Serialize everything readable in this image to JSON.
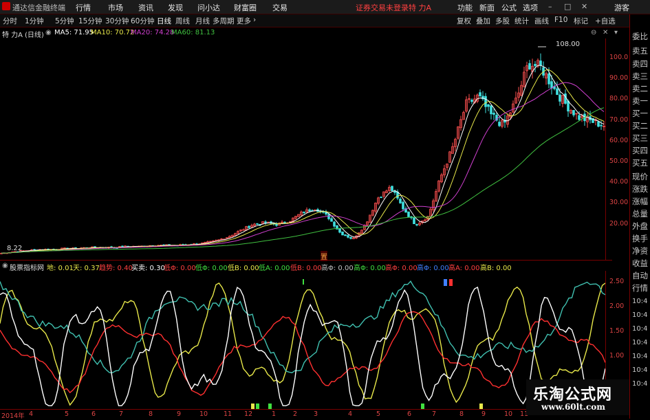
{
  "app": {
    "title": "通达信金融终端"
  },
  "menu": [
    "行情",
    "市场",
    "资讯",
    "发现",
    "问小达",
    "财富圈",
    "交易"
  ],
  "status": {
    "login": "证券交易未登录",
    "stock": "特 力A"
  },
  "menu_right": [
    "功能",
    "新面",
    "公式",
    "选项"
  ],
  "guest": "游客",
  "toolbar": [
    "分时",
    "1分钟",
    "5分钟",
    "15分钟",
    "30分钟",
    "60分钟",
    "日线",
    "周线",
    "月线",
    "多周期",
    "更多"
  ],
  "toolbar_active": "日线",
  "toolbar_right": [
    "复权",
    "叠加",
    "多股",
    "统计",
    "画线",
    "F10",
    "标记",
    "+自选"
  ],
  "corner": {
    "l": "L",
    "r": "R"
  },
  "ma_line": {
    "stock": "特 力A",
    "period": "(日线)",
    "ma5": "MA5: 71.95",
    "ma10": "MA10: 70.72",
    "ma20": "MA20: 74.28",
    "ma60": "MA60: 81.13"
  },
  "price_axis": [
    "100.0",
    "90.00",
    "80.00",
    "70.00",
    "60.00",
    "50.00",
    "40.00",
    "30.00",
    "20.00"
  ],
  "price_labels": {
    "high": "108.00",
    "low": "8.22",
    "tag": "置"
  },
  "ind_line": {
    "name": "股票指标网",
    "items": [
      {
        "label": "地: 0.01",
        "color": "#e8e84a"
      },
      {
        "label": "天: 0.37",
        "color": "#e8e84a"
      },
      {
        "label": "趋势: 0.40",
        "color": "#ff4040"
      },
      {
        "label": "买卖: 0.30",
        "color": "#ffffff"
      },
      {
        "label": "低Φ: 0.00",
        "color": "#ff4040"
      },
      {
        "label": "低Φ: 0.00",
        "color": "#40e040"
      },
      {
        "label": "低B: 0.00",
        "color": "#e8e84a"
      },
      {
        "label": "低A: 0.00",
        "color": "#40e040"
      },
      {
        "label": "低B: 0.00",
        "color": "#ff4040"
      },
      {
        "label": "高Φ: 0.00",
        "color": "#c0c0c0"
      },
      {
        "label": "高Φ: 0.00",
        "color": "#40e040"
      },
      {
        "label": "高Φ: 0.00",
        "color": "#ff4040"
      },
      {
        "label": "高Φ: 0.00",
        "color": "#4080ff"
      },
      {
        "label": "高A: 0.00",
        "color": "#ff4040"
      },
      {
        "label": "高B: 0.00",
        "color": "#e8e84a"
      }
    ]
  },
  "ind_axis": [
    "2.50",
    "2.00",
    "1.50",
    "1.00"
  ],
  "x_axis": [
    "2014年",
    "4",
    "5",
    "6",
    "7",
    "8",
    "9",
    "10",
    "11",
    "12",
    "1",
    "2",
    "3",
    "4",
    "5",
    "6",
    "7",
    "8",
    "9",
    "10",
    "11"
  ],
  "right_panel": [
    "委比",
    "卖五",
    "卖四",
    "卖三",
    "卖二",
    "卖一",
    "买一",
    "买二",
    "买三",
    "买四",
    "买五",
    "现价",
    "涨跌",
    "涨幅",
    "总量",
    "外盘",
    "换手",
    "净资",
    "收益",
    "自动",
    "行情"
  ],
  "right_times": [
    "10:4",
    "10:4",
    "10:4",
    "10:4",
    "10:4",
    "10:4",
    "10:4"
  ],
  "watermark": {
    "title": "乐淘公式网",
    "url": "www.60lt.com"
  },
  "chart_data": [
    {
      "type": "candlestick",
      "title": "特 力A (日线)",
      "series": [
        {
          "name": "MA5",
          "color": "#ffffff",
          "last": 71.95
        },
        {
          "name": "MA10",
          "color": "#e8e84a",
          "last": 70.72
        },
        {
          "name": "MA20",
          "color": "#d040d0",
          "last": 74.28
        },
        {
          "name": "MA60",
          "color": "#40c040",
          "last": 81.13
        }
      ],
      "ylim": [
        5,
        112
      ],
      "approx_close": [
        8.2,
        9,
        9.5,
        10,
        10,
        10.5,
        10.5,
        11,
        11,
        11,
        11.5,
        11.5,
        12,
        12,
        12,
        12.5,
        13,
        14,
        16,
        19,
        22,
        23,
        22,
        24,
        28,
        30,
        26,
        18,
        15,
        22,
        35,
        40,
        30,
        22,
        26,
        45,
        60,
        80,
        84,
        75,
        70,
        82,
        100,
        98,
        88,
        80,
        74,
        72,
        70
      ],
      "high_label": 108.0,
      "low_label": 8.22
    },
    {
      "type": "line",
      "title": "股票指标网",
      "ylim": [
        0.7,
        2.8
      ],
      "series": [
        {
          "name": "地",
          "color": "#e8e84a",
          "last": 0.01
        },
        {
          "name": "天",
          "color": "#e8e84a",
          "last": 0.37
        },
        {
          "name": "趋势",
          "color": "#ff4040",
          "last": 0.4
        },
        {
          "name": "买卖",
          "color": "#ffffff",
          "last": 0.3
        }
      ]
    }
  ]
}
